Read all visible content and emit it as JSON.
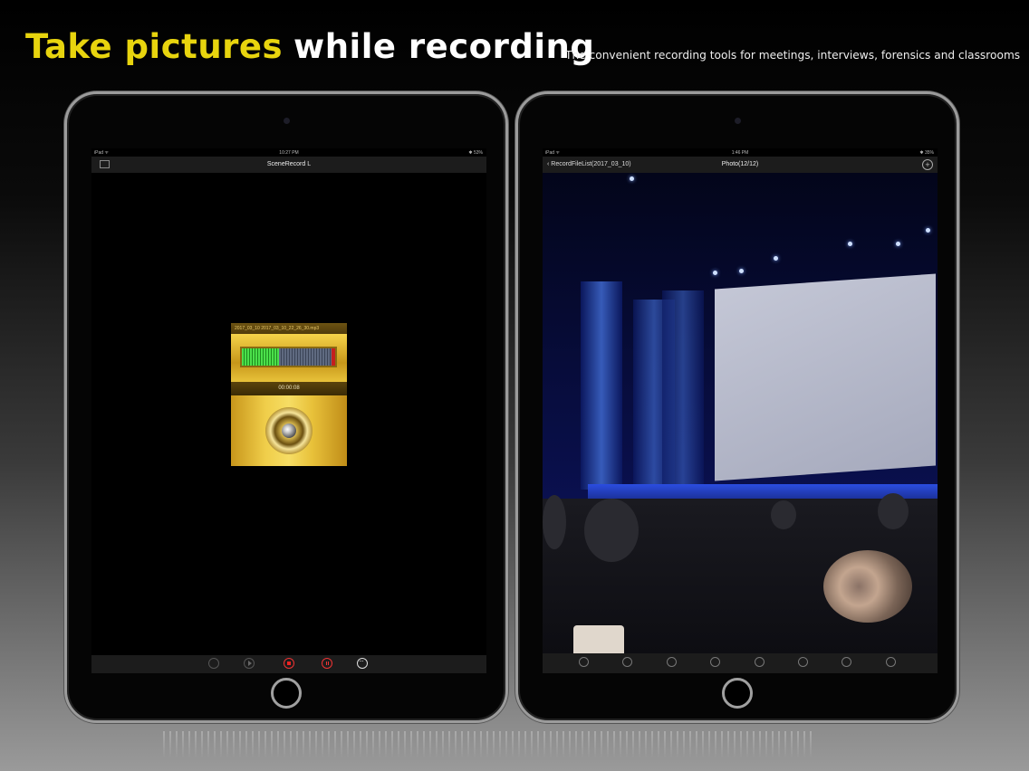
{
  "headline": {
    "yellow": "Take pictures",
    "white": "while recording"
  },
  "tagline": "The convenient recording tools for meetings, interviews, forensics and classrooms",
  "left_device": {
    "status": {
      "carrier": "iPad ᯤ",
      "time": "10:27 PM",
      "battery": "✱ 53%"
    },
    "nav_title": "SceneRecord L",
    "recorder": {
      "file_label": "2017_03_10    2017_03_10_22_26_30.mp3",
      "timer": "00:00:08",
      "level": 0.4
    },
    "toolbar_icons": [
      "rewind-icon",
      "play-icon",
      "record-stop-icon",
      "pause-icon",
      "more-icon"
    ]
  },
  "right_device": {
    "status": {
      "carrier": "iPad ᯤ",
      "time": "1:46 PM",
      "battery": "✱ 35%"
    },
    "nav_back": "‹ RecordFileList(2017_03_10)",
    "nav_title": "Photo(12/12)",
    "toolbar_icons": [
      "photo-icon",
      "crop-icon",
      "stack-icon",
      "clock-icon",
      "edit-icon",
      "share-icon",
      "trash-icon",
      "camera-icon"
    ]
  }
}
